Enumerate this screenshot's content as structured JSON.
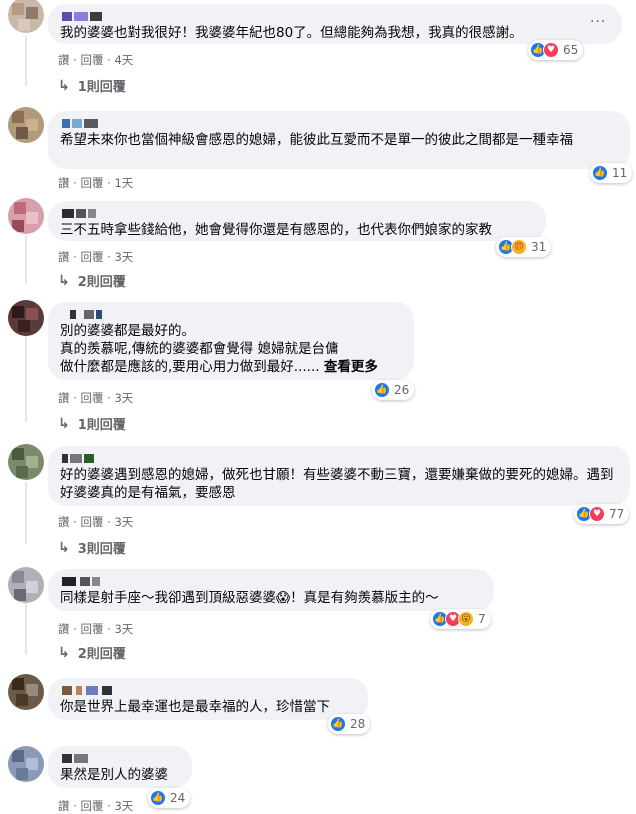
{
  "comments": [
    {
      "text": "我的婆婆也對我很好！我婆婆年紀也80了。但總能夠為我想，我真的很感謝。",
      "actions": [
        "讚",
        "回覆",
        "4天"
      ],
      "reaction_count": "65",
      "reactions": [
        "like",
        "love"
      ],
      "replies": "1則回覆",
      "more": "···"
    },
    {
      "text": "希望未來你也當個神級會感恩的媳婦，能彼此互愛而不是單一的彼此之間都是一種幸福",
      "actions": [
        "讚",
        "回覆",
        "1天"
      ],
      "reaction_count": "11",
      "reactions": [
        "like"
      ]
    },
    {
      "text": "三不五時拿些錢給他，她會覺得你還是有感恩的，也代表你們娘家的家教",
      "actions": [
        "讚",
        "回覆",
        "3天"
      ],
      "reaction_count": "31",
      "reactions": [
        "like",
        "angry"
      ],
      "replies": "2則回覆"
    },
    {
      "text_lines": [
        "別的婆婆都是最好的。",
        "真的羨慕呢,傳統的婆婆都會覺得 媳婦就是台傭",
        "做什麼都是應該的,要用心用力做到最好......"
      ],
      "see_more": "查看更多",
      "actions": [
        "讚",
        "回覆",
        "3天"
      ],
      "reaction_count": "26",
      "reactions": [
        "like"
      ],
      "replies": "1則回覆"
    },
    {
      "text": "好的婆婆遇到感恩的媳婦，做死也甘願！有些婆婆不動三寶，還要嫌棄做的要死的媳婦。遇到好婆婆真的是有福氣，要感恩",
      "actions": [
        "讚",
        "回覆",
        "3天"
      ],
      "reaction_count": "77",
      "reactions": [
        "like",
        "love"
      ],
      "replies": "3則回覆"
    },
    {
      "text": "同樣是射手座～我卻遇到頂級惡婆婆😱！真是有夠羨慕版主的～",
      "actions": [
        "讚",
        "回覆",
        "3天"
      ],
      "reaction_count": "7",
      "reactions": [
        "like",
        "love",
        "wow"
      ],
      "replies": "2則回覆"
    },
    {
      "text": "你是世界上最幸運也是最幸福的人，珍惜當下",
      "actions": [
        "讚",
        "回覆",
        "3天"
      ],
      "reaction_count": "28",
      "reactions": [
        "like"
      ]
    },
    {
      "text": "果然是別人的婆婆",
      "actions": [
        "讚",
        "回覆",
        "3天"
      ],
      "reaction_count": "24",
      "reactions": [
        "like"
      ]
    }
  ],
  "icons": {
    "like": "thumbs-up-icon",
    "love": "heart-icon",
    "angry": "angry-face-icon",
    "wow": "wow-face-icon",
    "reply_arrow": "reply-arrow-icon"
  },
  "colors": {
    "bubble": "#f0f2f5",
    "like": "#1877f2",
    "love": "#f33e58",
    "meta": "#65676b"
  }
}
